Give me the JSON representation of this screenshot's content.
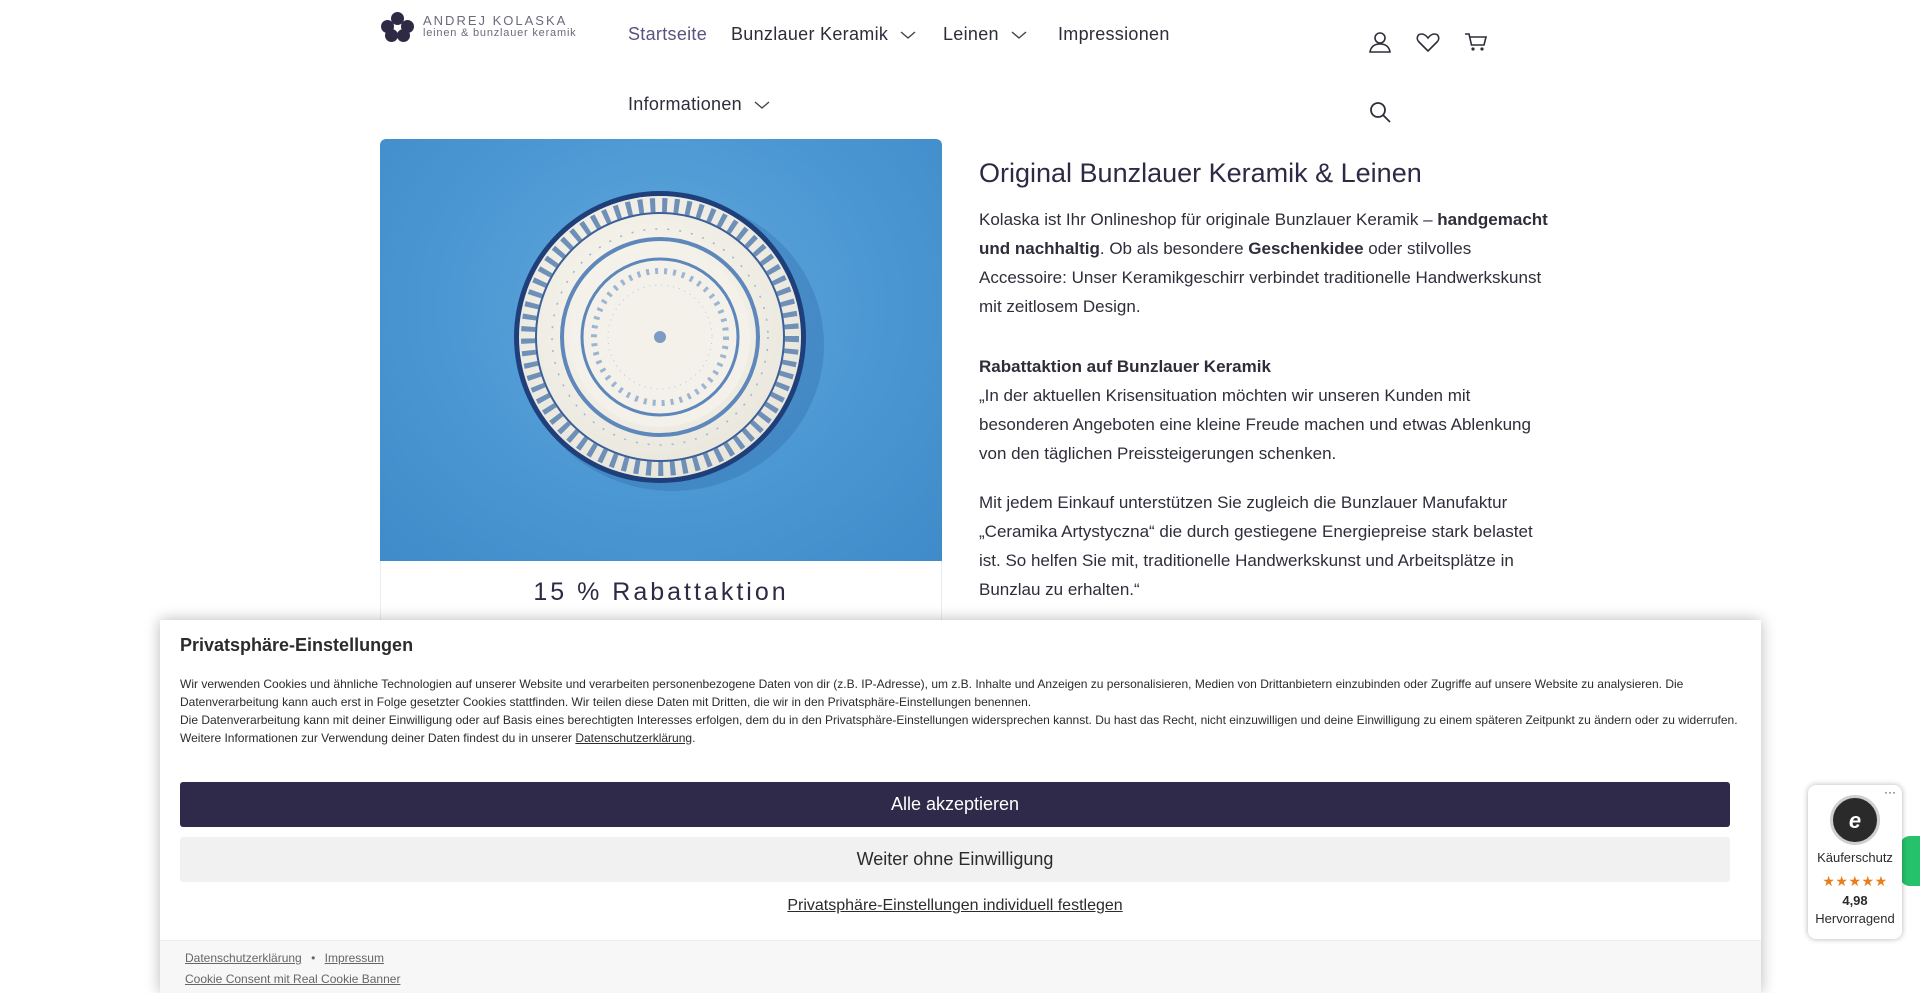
{
  "header": {
    "logo": {
      "line1": "ANDREJ KOLASKA",
      "line2": "leinen & bunzlauer keramik"
    },
    "nav": [
      {
        "label": "Startseite"
      },
      {
        "label": "Bunzlauer Keramik"
      },
      {
        "label": "Leinen"
      },
      {
        "label": "Impressionen"
      },
      {
        "label": "Informationen"
      }
    ],
    "icons": [
      "user-icon",
      "heart-icon",
      "cart-icon",
      "search-icon"
    ]
  },
  "promo": {
    "title": "15 % Rabattaktion"
  },
  "content": {
    "title": "Original Bunzlauer Keramik & Leinen",
    "intro": {
      "t1": "Kolaska ist Ihr Onlineshop für originale Bunzlauer Keramik – ",
      "b1": "handgemacht und nachhaltig",
      "t2": ". Ob als besondere ",
      "b2": "Geschenkidee",
      "t3": " oder stilvolles Accessoire: Unser Keramikgeschirr verbindet traditionelle Handwerkskunst mit zeitlosem Design."
    },
    "rabatt_heading": "Rabattaktion auf Bunzlauer Keramik",
    "rabatt_text": "„In der aktuellen Krisensituation möchten wir unseren Kunden mit besonderen Angeboten eine kleine Freude machen und etwas Ablenkung von den täglichen Preissteigerungen schenken.",
    "support_text": "Mit jedem Einkauf unterstützen Sie zugleich die Bunzlauer Manufaktur „Ceramika Artystyczna“ die durch gestiegene Energiepreise stark belastet ist. So helfen Sie mit, traditionelle Handwerkskunst und Arbeitsplätze in Bunzlau zu erhalten.“"
  },
  "cookie": {
    "title": "Privatsphäre-Einstellungen",
    "p1": "Wir verwenden Cookies und ähnliche Technologien auf unserer Website und verarbeiten personenbezogene Daten von dir (z.B. IP-Adresse), um z.B. Inhalte und Anzeigen zu personalisieren, Medien von Drittanbietern einzubinden oder Zugriffe auf unsere Website zu analysieren. Die Datenverarbeitung kann auch erst in Folge gesetzter Cookies stattfinden. Wir teilen diese Daten mit Dritten, die wir in den Privatsphäre-Einstellungen benennen.",
    "p2": "Die Datenverarbeitung kann mit deiner Einwilligung oder auf Basis eines berechtigten Interesses erfolgen, dem du in den Privatsphäre-Einstellungen widersprechen kannst. Du hast das Recht, nicht einzuwilligen und deine Einwilligung zu einem späteren Zeitpunkt zu ändern oder zu widerrufen. Weitere Informationen zur Verwendung deiner Daten findest du in unserer ",
    "p2_link": "Datenschutzerklärung",
    "p2_end": ".",
    "accept": "Alle akzeptieren",
    "continue": "Weiter ohne Einwilligung",
    "custom": "Privatsphäre-Einstellungen individuell festlegen",
    "footer": {
      "privacy": "Datenschutzerklärung",
      "sep": "•",
      "imprint": "Impressum",
      "rcb": "Cookie Consent mit Real Cookie Banner"
    }
  },
  "trust_badge": {
    "seal_letter": "e",
    "dots": "···",
    "label": "Käuferschutz",
    "stars": "★★★★★",
    "score": "4,98",
    "rating": "Hervorragend"
  },
  "colors": {
    "brand_dark": "#302a4a",
    "nav_active": "#5a5280",
    "hero_blue": "#4b97d3",
    "star_orange": "#e67f1b",
    "chat_green": "#25c26b"
  }
}
